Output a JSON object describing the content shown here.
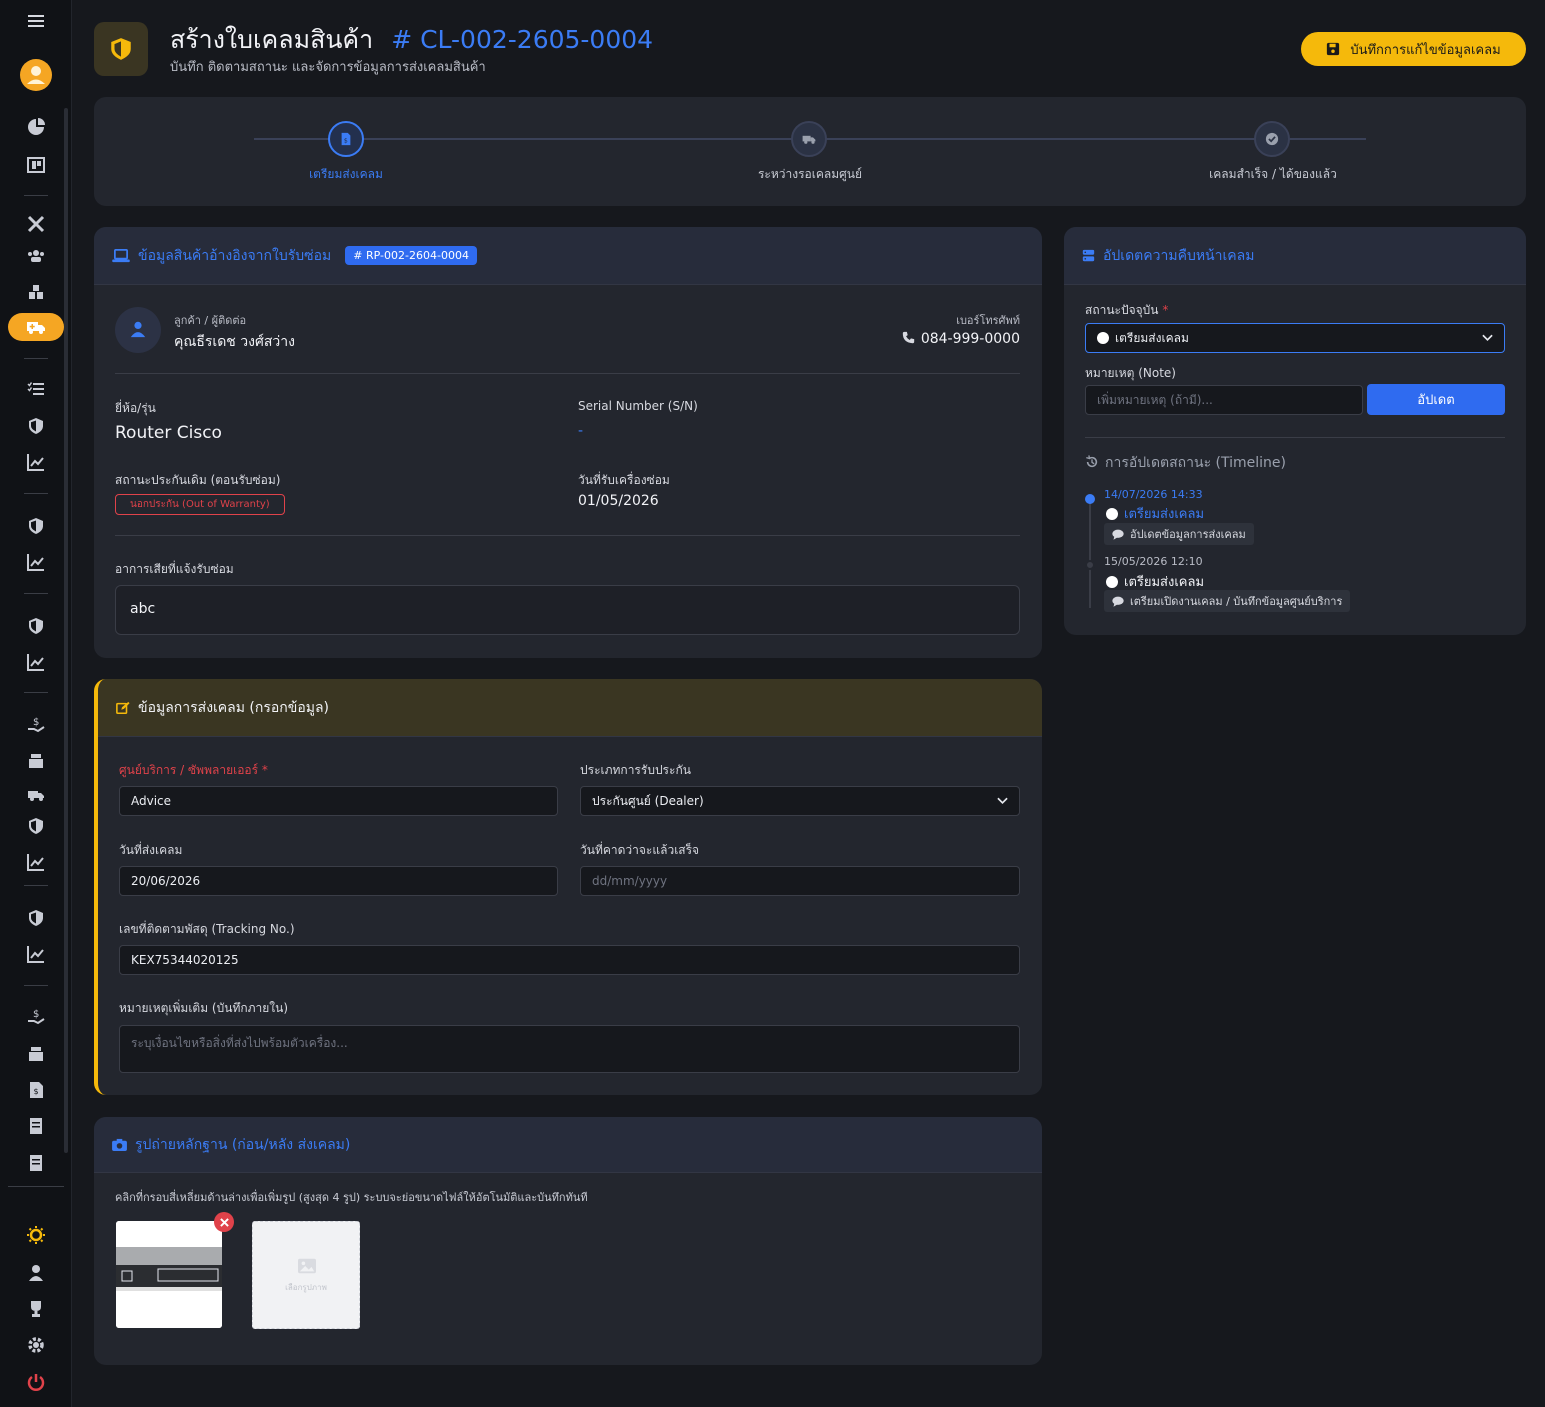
{
  "header": {
    "title": "สร้างใบเคลมสินค้า",
    "claim_code": "# CL-002-2605-0004",
    "subtitle": "บันทึก ติดตามสถานะ และจัดการข้อมูลการส่งเคลมสินค้า",
    "save_label": "บันทึกการแก้ไขข้อมูลเคลม"
  },
  "stepper": {
    "steps": [
      {
        "label": "เตรียมส่งเคลม",
        "active": true
      },
      {
        "label": "ระหว่างรอเคลมศูนย์",
        "active": false
      },
      {
        "label": "เคลมสำเร็จ / ได้ของแล้ว",
        "active": false
      }
    ]
  },
  "product_card": {
    "title": "ข้อมูลสินค้าอ้างอิงจากใบรับซ่อม",
    "ref_tag": "RP-002-2604-0004",
    "customer_label": "ลูกค้า / ผู้ติดต่อ",
    "customer_name": "คุณธีรเดช วงศ์สว่าง",
    "phone_label": "เบอร์โทรศัพท์",
    "phone": "084-999-0000",
    "brand_label": "ยี่ห้อ/รุ่น",
    "brand": "Router Cisco",
    "serial_label": "Serial Number (S/N)",
    "serial": "-",
    "warranty_label": "สถานะประกันเดิม (ตอนรับซ่อม)",
    "warranty_badge": "นอกประกัน (Out of Warranty)",
    "received_label": "วันที่รับเครื่องซ่อม",
    "received_date": "01/05/2026",
    "symptom_label": "อาการเสียที่แจ้งรับซ่อม",
    "symptom": "abc"
  },
  "claim_form": {
    "title": "ข้อมูลการส่งเคลม (กรอกข้อมูล)",
    "supplier_label": "ศูนย์บริการ / ซัพพลายเออร์ *",
    "supplier_value": "Advice",
    "warranty_type_label": "ประเภทการรับประกัน",
    "warranty_type_value": "ประกันศูนย์ (Dealer)",
    "send_date_label": "วันที่ส่งเคลม",
    "send_date_value": "20/06/2026",
    "expected_label": "วันที่คาดว่าจะแล้วเสร็จ",
    "expected_placeholder": "dd/mm/yyyy",
    "tracking_label": "เลขที่ติดตามพัสดุ (Tracking No.)",
    "tracking_value": "KEX75344020125",
    "note_label": "หมายเหตุเพิ่มเติม (บันทึกภายใน)",
    "note_placeholder": "ระบุเงื่อนไขหรือสิ่งที่ส่งไปพร้อมตัวเครื่อง..."
  },
  "photos": {
    "title": "รูปถ่ายหลักฐาน (ก่อน/หลัง ส่งเคลม)",
    "hint": "คลิกที่กรอบสี่เหลี่ยมด้านล่างเพื่อเพิ่มรูป (สูงสุด 4 รูป) ระบบจะย่อขนาดไฟล์ให้อัตโนมัติและบันทึกทันที",
    "add_label": "เลือกรูปภาพ"
  },
  "progress_card": {
    "title": "อัปเดตความคืบหน้าเคลม",
    "status_label": "สถานะปัจจุบัน",
    "status_required": "*",
    "status_value": "เตรียมส่งเคลม",
    "note_label": "หมายเหตุ (Note)",
    "note_placeholder": "เพิ่มหมายเหตุ (ถ้ามี)...",
    "update_label": "อัปเดต",
    "timeline_title": "การอัปเดตสถานะ (Timeline)",
    "timeline": [
      {
        "time": "14/07/2026 14:33",
        "status": "เตรียมส่งเคลม",
        "note": "อัปเดตข้อมูลการส่งเคลม",
        "latest": true
      },
      {
        "time": "15/05/2026 12:10",
        "status": "เตรียมส่งเคลม",
        "note": "เตรียมเปิดงานเคลม / บันทึกข้อมูลศูนย์บริการ",
        "latest": false
      }
    ]
  },
  "colors": {
    "accent": "#3b7cf5",
    "brand_yellow": "#f5b90b",
    "danger": "#e0424a",
    "sidebar_active": "#f5a623"
  }
}
